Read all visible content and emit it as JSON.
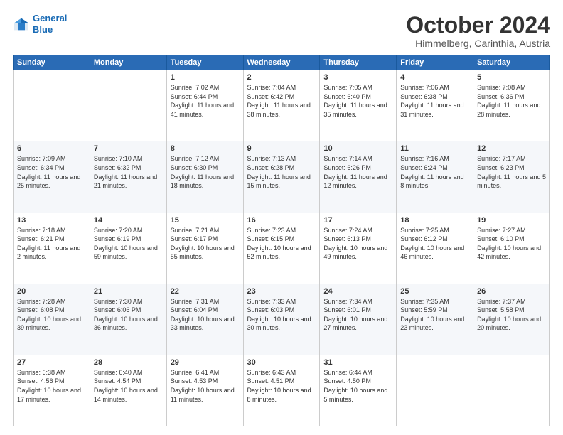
{
  "header": {
    "logo_line1": "General",
    "logo_line2": "Blue",
    "month": "October 2024",
    "location": "Himmelberg, Carinthia, Austria"
  },
  "weekdays": [
    "Sunday",
    "Monday",
    "Tuesday",
    "Wednesday",
    "Thursday",
    "Friday",
    "Saturday"
  ],
  "weeks": [
    [
      {
        "day": "",
        "info": ""
      },
      {
        "day": "",
        "info": ""
      },
      {
        "day": "1",
        "info": "Sunrise: 7:02 AM\nSunset: 6:44 PM\nDaylight: 11 hours and 41 minutes."
      },
      {
        "day": "2",
        "info": "Sunrise: 7:04 AM\nSunset: 6:42 PM\nDaylight: 11 hours and 38 minutes."
      },
      {
        "day": "3",
        "info": "Sunrise: 7:05 AM\nSunset: 6:40 PM\nDaylight: 11 hours and 35 minutes."
      },
      {
        "day": "4",
        "info": "Sunrise: 7:06 AM\nSunset: 6:38 PM\nDaylight: 11 hours and 31 minutes."
      },
      {
        "day": "5",
        "info": "Sunrise: 7:08 AM\nSunset: 6:36 PM\nDaylight: 11 hours and 28 minutes."
      }
    ],
    [
      {
        "day": "6",
        "info": "Sunrise: 7:09 AM\nSunset: 6:34 PM\nDaylight: 11 hours and 25 minutes."
      },
      {
        "day": "7",
        "info": "Sunrise: 7:10 AM\nSunset: 6:32 PM\nDaylight: 11 hours and 21 minutes."
      },
      {
        "day": "8",
        "info": "Sunrise: 7:12 AM\nSunset: 6:30 PM\nDaylight: 11 hours and 18 minutes."
      },
      {
        "day": "9",
        "info": "Sunrise: 7:13 AM\nSunset: 6:28 PM\nDaylight: 11 hours and 15 minutes."
      },
      {
        "day": "10",
        "info": "Sunrise: 7:14 AM\nSunset: 6:26 PM\nDaylight: 11 hours and 12 minutes."
      },
      {
        "day": "11",
        "info": "Sunrise: 7:16 AM\nSunset: 6:24 PM\nDaylight: 11 hours and 8 minutes."
      },
      {
        "day": "12",
        "info": "Sunrise: 7:17 AM\nSunset: 6:23 PM\nDaylight: 11 hours and 5 minutes."
      }
    ],
    [
      {
        "day": "13",
        "info": "Sunrise: 7:18 AM\nSunset: 6:21 PM\nDaylight: 11 hours and 2 minutes."
      },
      {
        "day": "14",
        "info": "Sunrise: 7:20 AM\nSunset: 6:19 PM\nDaylight: 10 hours and 59 minutes."
      },
      {
        "day": "15",
        "info": "Sunrise: 7:21 AM\nSunset: 6:17 PM\nDaylight: 10 hours and 55 minutes."
      },
      {
        "day": "16",
        "info": "Sunrise: 7:23 AM\nSunset: 6:15 PM\nDaylight: 10 hours and 52 minutes."
      },
      {
        "day": "17",
        "info": "Sunrise: 7:24 AM\nSunset: 6:13 PM\nDaylight: 10 hours and 49 minutes."
      },
      {
        "day": "18",
        "info": "Sunrise: 7:25 AM\nSunset: 6:12 PM\nDaylight: 10 hours and 46 minutes."
      },
      {
        "day": "19",
        "info": "Sunrise: 7:27 AM\nSunset: 6:10 PM\nDaylight: 10 hours and 42 minutes."
      }
    ],
    [
      {
        "day": "20",
        "info": "Sunrise: 7:28 AM\nSunset: 6:08 PM\nDaylight: 10 hours and 39 minutes."
      },
      {
        "day": "21",
        "info": "Sunrise: 7:30 AM\nSunset: 6:06 PM\nDaylight: 10 hours and 36 minutes."
      },
      {
        "day": "22",
        "info": "Sunrise: 7:31 AM\nSunset: 6:04 PM\nDaylight: 10 hours and 33 minutes."
      },
      {
        "day": "23",
        "info": "Sunrise: 7:33 AM\nSunset: 6:03 PM\nDaylight: 10 hours and 30 minutes."
      },
      {
        "day": "24",
        "info": "Sunrise: 7:34 AM\nSunset: 6:01 PM\nDaylight: 10 hours and 27 minutes."
      },
      {
        "day": "25",
        "info": "Sunrise: 7:35 AM\nSunset: 5:59 PM\nDaylight: 10 hours and 23 minutes."
      },
      {
        "day": "26",
        "info": "Sunrise: 7:37 AM\nSunset: 5:58 PM\nDaylight: 10 hours and 20 minutes."
      }
    ],
    [
      {
        "day": "27",
        "info": "Sunrise: 6:38 AM\nSunset: 4:56 PM\nDaylight: 10 hours and 17 minutes."
      },
      {
        "day": "28",
        "info": "Sunrise: 6:40 AM\nSunset: 4:54 PM\nDaylight: 10 hours and 14 minutes."
      },
      {
        "day": "29",
        "info": "Sunrise: 6:41 AM\nSunset: 4:53 PM\nDaylight: 10 hours and 11 minutes."
      },
      {
        "day": "30",
        "info": "Sunrise: 6:43 AM\nSunset: 4:51 PM\nDaylight: 10 hours and 8 minutes."
      },
      {
        "day": "31",
        "info": "Sunrise: 6:44 AM\nSunset: 4:50 PM\nDaylight: 10 hours and 5 minutes."
      },
      {
        "day": "",
        "info": ""
      },
      {
        "day": "",
        "info": ""
      }
    ]
  ]
}
